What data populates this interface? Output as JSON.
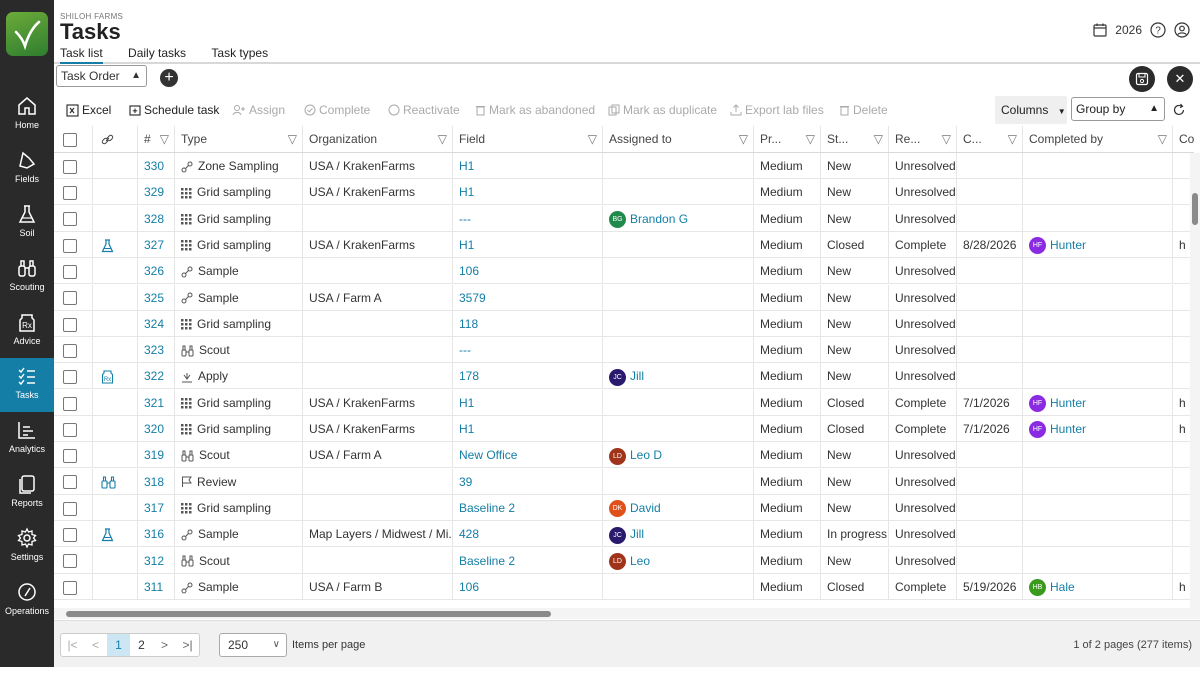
{
  "nav": {
    "items": [
      {
        "label": "Home",
        "icon": "home-icon"
      },
      {
        "label": "Fields",
        "icon": "fields-icon"
      },
      {
        "label": "Soil",
        "icon": "flask-icon"
      },
      {
        "label": "Scouting",
        "icon": "binoculars-icon"
      },
      {
        "label": "Advice",
        "icon": "prescription-icon"
      },
      {
        "label": "Tasks",
        "icon": "tasks-icon"
      },
      {
        "label": "Analytics",
        "icon": "analytics-icon"
      },
      {
        "label": "Reports",
        "icon": "reports-icon"
      },
      {
        "label": "Settings",
        "icon": "gear-icon"
      },
      {
        "label": "Operations",
        "icon": "gauge-icon"
      }
    ],
    "active": "Tasks"
  },
  "header": {
    "org": "SHILOH FARMS",
    "title": "Tasks",
    "tabs": [
      "Task list",
      "Daily tasks",
      "Task types"
    ],
    "active_tab": "Task list",
    "year": "2026"
  },
  "controls": {
    "order_select": "Task Order"
  },
  "toolbar": {
    "excel": "Excel",
    "schedule": "Schedule task",
    "assign": "Assign",
    "complete": "Complete",
    "reactivate": "Reactivate",
    "abandon": "Mark as abandoned",
    "duplicate": "Mark as duplicate",
    "export": "Export lab files",
    "delete": "Delete",
    "columns": "Columns",
    "groupby": "Group by"
  },
  "grid": {
    "headers": {
      "num": "#",
      "type": "Type",
      "org": "Organization",
      "field": "Field",
      "assigned": "Assigned to",
      "priority": "Pr...",
      "status": "St...",
      "resolution": "Re...",
      "completed": "C...",
      "completed_by": "Completed by",
      "last": "Co"
    },
    "rows": [
      {
        "link": "",
        "num": "330",
        "type": "Zone Sampling",
        "type_icon": "sample",
        "org": "USA / KrakenFarms",
        "field": "H1",
        "assigned": "",
        "initials": "",
        "avatar": "",
        "priority": "Medium",
        "status": "New",
        "resolution": "Unresolved",
        "completed": "",
        "cby": "",
        "cby_initials": "",
        "cby_avatar": "",
        "extra": ""
      },
      {
        "link": "",
        "num": "329",
        "type": "Grid sampling",
        "type_icon": "grid",
        "org": "USA / KrakenFarms",
        "field": "H1",
        "assigned": "",
        "initials": "",
        "avatar": "",
        "priority": "Medium",
        "status": "New",
        "resolution": "Unresolved",
        "completed": "",
        "cby": "",
        "cby_initials": "",
        "cby_avatar": "",
        "extra": ""
      },
      {
        "link": "",
        "num": "328",
        "type": "Grid sampling",
        "type_icon": "grid",
        "org": "",
        "field": "---",
        "assigned": "Brandon G",
        "initials": "BG",
        "avatar": "#1f8a4c",
        "priority": "Medium",
        "status": "New",
        "resolution": "Unresolved",
        "completed": "",
        "cby": "",
        "cby_initials": "",
        "cby_avatar": "",
        "extra": ""
      },
      {
        "link": "flask",
        "num": "327",
        "type": "Grid sampling",
        "type_icon": "grid",
        "org": "USA / KrakenFarms",
        "field": "H1",
        "assigned": "",
        "initials": "",
        "avatar": "",
        "priority": "Medium",
        "status": "Closed",
        "resolution": "Complete",
        "completed": "8/28/2026",
        "cby": "Hunter",
        "cby_initials": "HF",
        "cby_avatar": "#8a2be2",
        "extra": "h"
      },
      {
        "link": "",
        "num": "326",
        "type": "Sample",
        "type_icon": "sample",
        "org": "",
        "field": "106",
        "assigned": "",
        "initials": "",
        "avatar": "",
        "priority": "Medium",
        "status": "New",
        "resolution": "Unresolved",
        "completed": "",
        "cby": "",
        "cby_initials": "",
        "cby_avatar": "",
        "extra": ""
      },
      {
        "link": "",
        "num": "325",
        "type": "Sample",
        "type_icon": "sample",
        "org": "USA / Farm A",
        "field": "3579",
        "assigned": "",
        "initials": "",
        "avatar": "",
        "priority": "Medium",
        "status": "New",
        "resolution": "Unresolved",
        "completed": "",
        "cby": "",
        "cby_initials": "",
        "cby_avatar": "",
        "extra": ""
      },
      {
        "link": "",
        "num": "324",
        "type": "Grid sampling",
        "type_icon": "grid",
        "org": "",
        "field": "118",
        "assigned": "",
        "initials": "",
        "avatar": "",
        "priority": "Medium",
        "status": "New",
        "resolution": "Unresolved",
        "completed": "",
        "cby": "",
        "cby_initials": "",
        "cby_avatar": "",
        "extra": ""
      },
      {
        "link": "",
        "num": "323",
        "type": "Scout",
        "type_icon": "binoculars",
        "org": "",
        "field": "---",
        "assigned": "",
        "initials": "",
        "avatar": "",
        "priority": "Medium",
        "status": "New",
        "resolution": "Unresolved",
        "completed": "",
        "cby": "",
        "cby_initials": "",
        "cby_avatar": "",
        "extra": ""
      },
      {
        "link": "rx",
        "num": "322",
        "type": "Apply",
        "type_icon": "apply",
        "org": "",
        "field": "178",
        "assigned": "Jill",
        "initials": "JC",
        "avatar": "#2a1a6e",
        "priority": "Medium",
        "status": "New",
        "resolution": "Unresolved",
        "completed": "",
        "cby": "",
        "cby_initials": "",
        "cby_avatar": "",
        "extra": ""
      },
      {
        "link": "",
        "num": "321",
        "type": "Grid sampling",
        "type_icon": "grid",
        "org": "USA / KrakenFarms",
        "field": "H1",
        "assigned": "",
        "initials": "",
        "avatar": "",
        "priority": "Medium",
        "status": "Closed",
        "resolution": "Complete",
        "completed": "7/1/2026",
        "cby": "Hunter",
        "cby_initials": "HF",
        "cby_avatar": "#8a2be2",
        "extra": "h"
      },
      {
        "link": "",
        "num": "320",
        "type": "Grid sampling",
        "type_icon": "grid",
        "org": "USA / KrakenFarms",
        "field": "H1",
        "assigned": "",
        "initials": "",
        "avatar": "",
        "priority": "Medium",
        "status": "Closed",
        "resolution": "Complete",
        "completed": "7/1/2026",
        "cby": "Hunter",
        "cby_initials": "HF",
        "cby_avatar": "#8a2be2",
        "extra": "h"
      },
      {
        "link": "",
        "num": "319",
        "type": "Scout",
        "type_icon": "binoculars",
        "org": "USA / Farm A",
        "field": "New Office",
        "assigned": "Leo D",
        "initials": "LD",
        "avatar": "#a0341a",
        "priority": "Medium",
        "status": "New",
        "resolution": "Unresolved",
        "completed": "",
        "cby": "",
        "cby_initials": "",
        "cby_avatar": "",
        "extra": ""
      },
      {
        "link": "binoculars",
        "num": "318",
        "type": "Review",
        "type_icon": "flag",
        "org": "",
        "field": "39",
        "assigned": "",
        "initials": "",
        "avatar": "",
        "priority": "Medium",
        "status": "New",
        "resolution": "Unresolved",
        "completed": "",
        "cby": "",
        "cby_initials": "",
        "cby_avatar": "",
        "extra": ""
      },
      {
        "link": "",
        "num": "317",
        "type": "Grid sampling",
        "type_icon": "grid",
        "org": "",
        "field": "Baseline 2",
        "assigned": "David",
        "initials": "DK",
        "avatar": "#e0501a",
        "priority": "Medium",
        "status": "New",
        "resolution": "Unresolved",
        "completed": "",
        "cby": "",
        "cby_initials": "",
        "cby_avatar": "",
        "extra": ""
      },
      {
        "link": "flask",
        "num": "316",
        "type": "Sample",
        "type_icon": "sample",
        "org": "Map Layers / Midwest / Mi...",
        "field": "428",
        "assigned": "Jill",
        "initials": "JC",
        "avatar": "#2a1a6e",
        "priority": "Medium",
        "status": "In progress",
        "resolution": "Unresolved",
        "completed": "",
        "cby": "",
        "cby_initials": "",
        "cby_avatar": "",
        "extra": ""
      },
      {
        "link": "",
        "num": "312",
        "type": "Scout",
        "type_icon": "binoculars",
        "org": "",
        "field": "Baseline 2",
        "assigned": "Leo",
        "initials": "LD",
        "avatar": "#a0341a",
        "priority": "Medium",
        "status": "New",
        "resolution": "Unresolved",
        "completed": "",
        "cby": "",
        "cby_initials": "",
        "cby_avatar": "",
        "extra": ""
      },
      {
        "link": "",
        "num": "311",
        "type": "Sample",
        "type_icon": "sample",
        "org": "USA / Farm B",
        "field": "106",
        "assigned": "",
        "initials": "",
        "avatar": "",
        "priority": "Medium",
        "status": "Closed",
        "resolution": "Complete",
        "completed": "5/19/2026",
        "cby": "Hale",
        "cby_initials": "HB",
        "cby_avatar": "#3a9a1e",
        "extra": "h"
      }
    ]
  },
  "footer": {
    "pages": [
      "1",
      "2"
    ],
    "current_page": "1",
    "per_page": "250",
    "per_page_label": "Items per page",
    "summary": "1 of 2 pages (277 items)"
  },
  "colors": {
    "accent": "#147ea6",
    "nav_bg": "#2a2a2a",
    "logo": "#4a9a30"
  }
}
